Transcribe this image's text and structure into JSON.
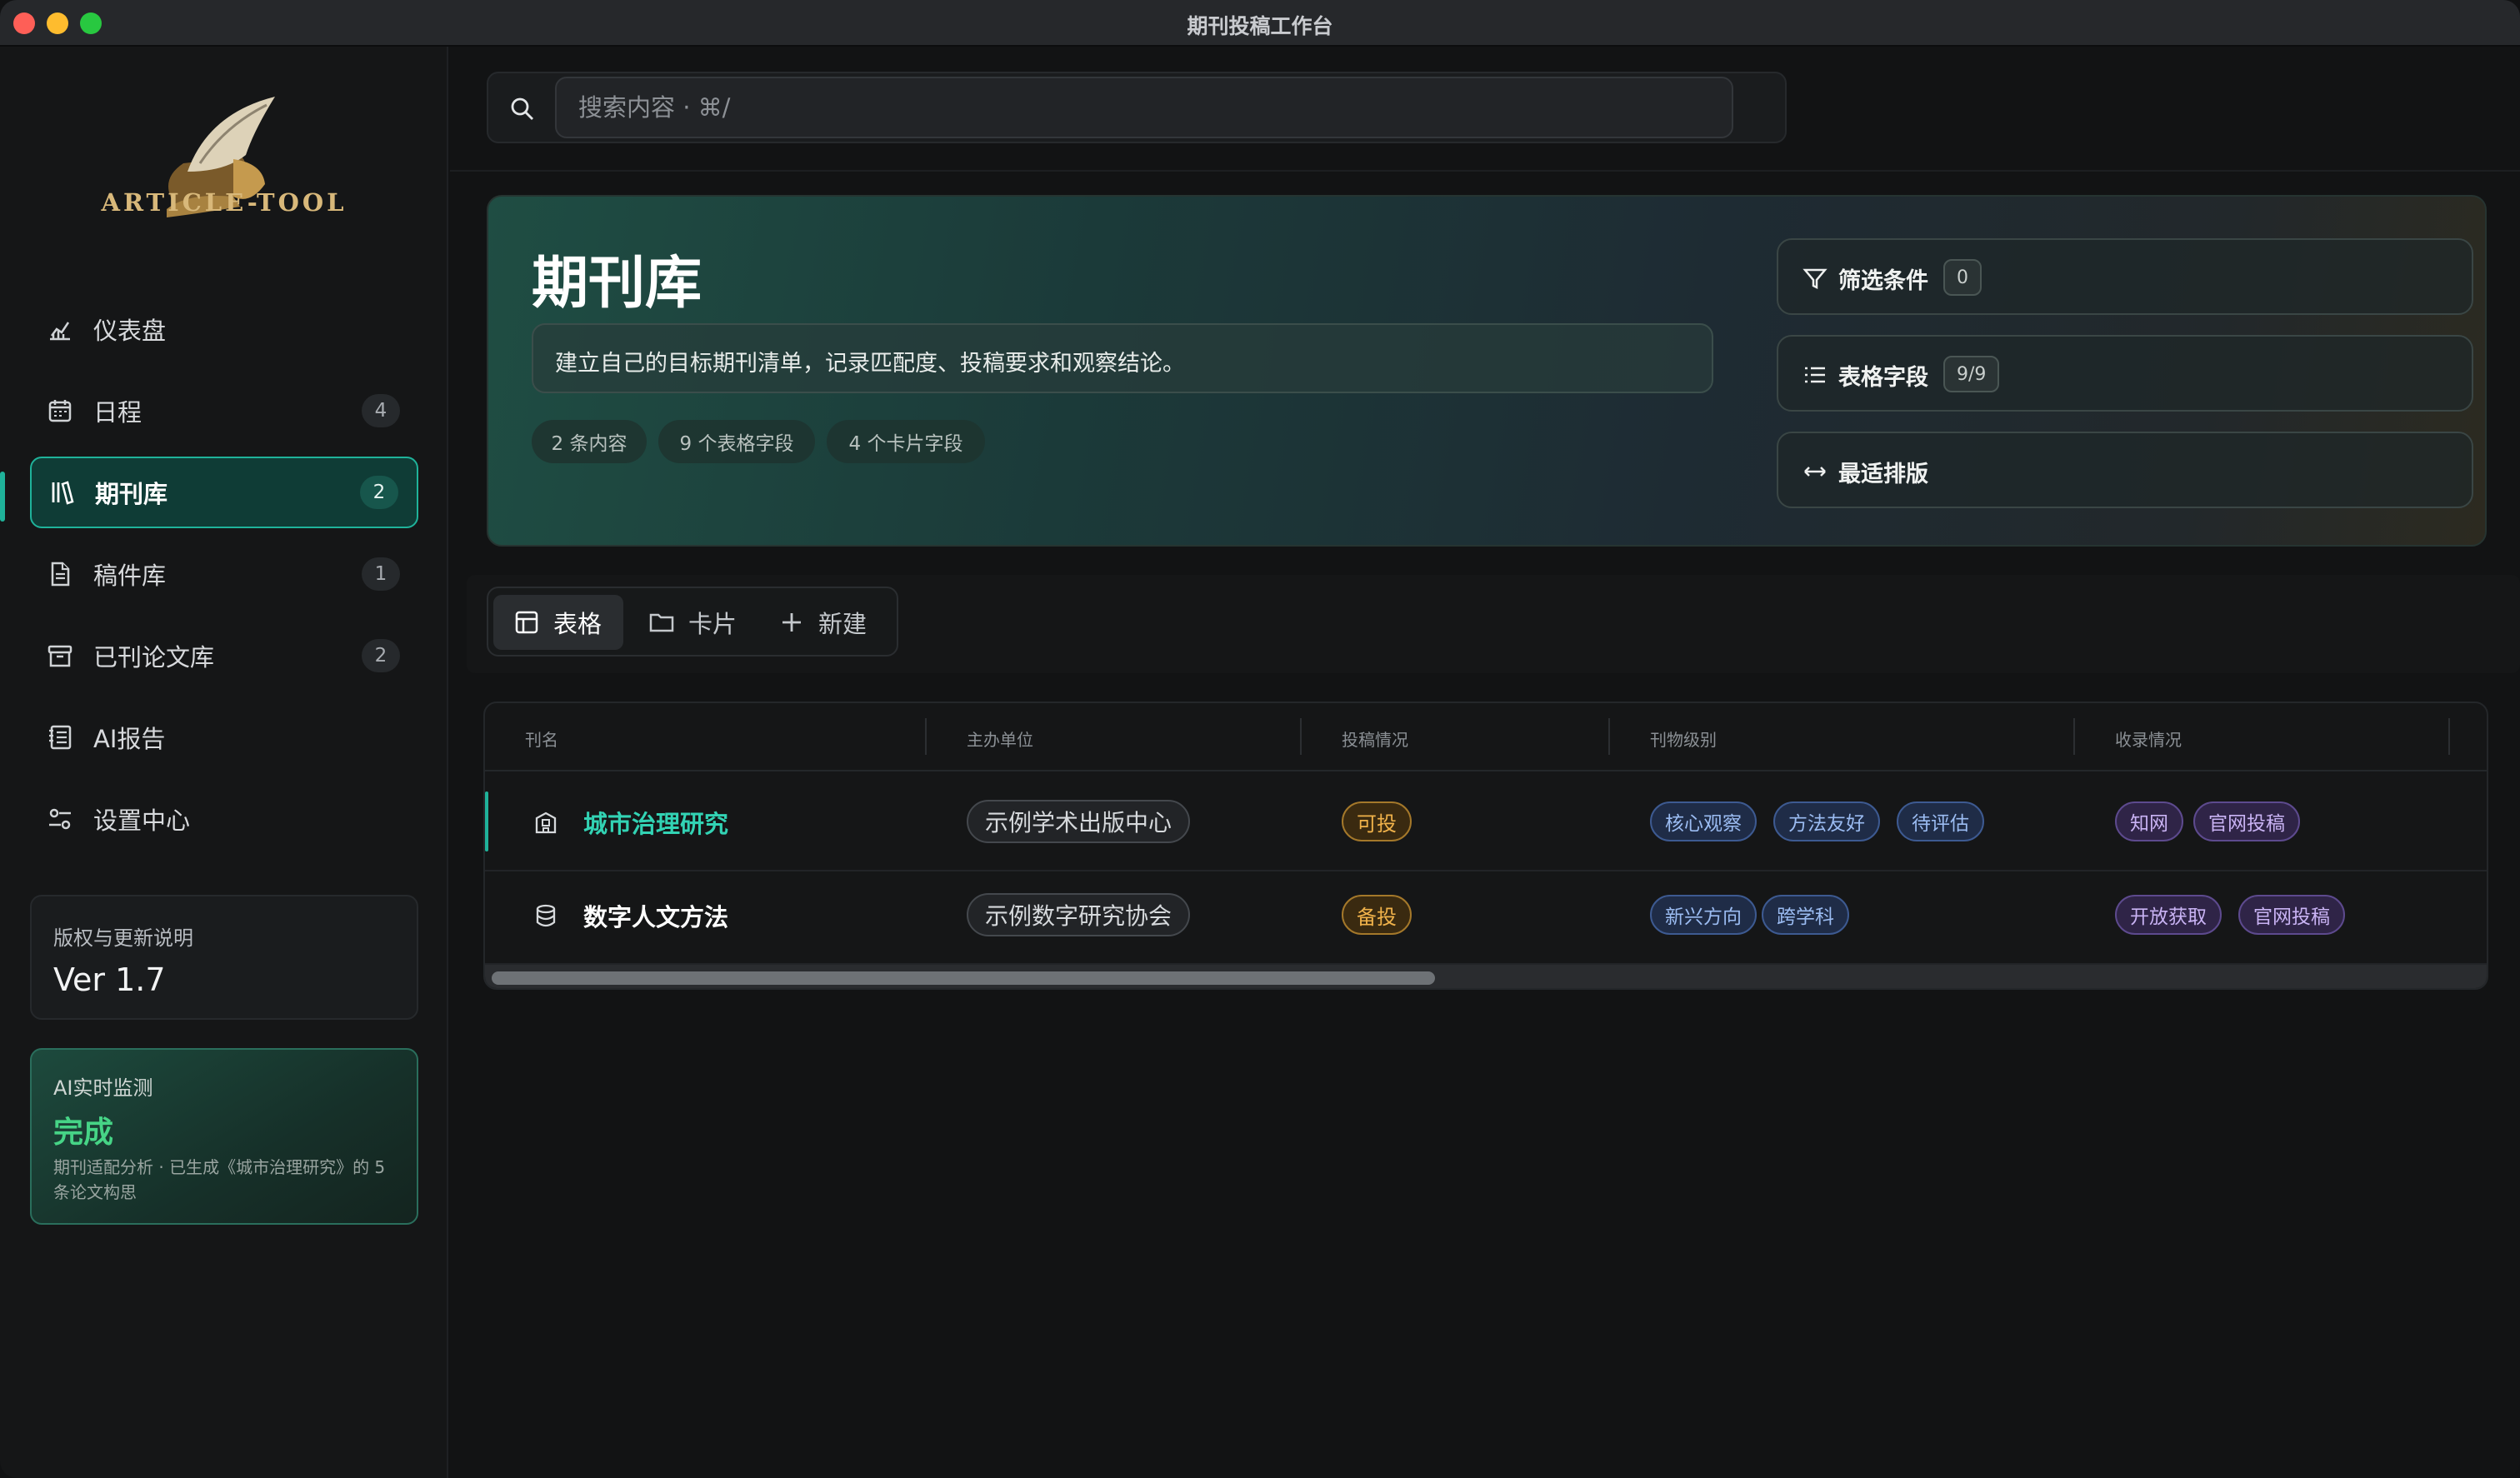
{
  "window": {
    "title": "期刊投稿工作台"
  },
  "brand": {
    "logo_text": "ARTICLE-TOOL"
  },
  "sidebar": {
    "items": [
      {
        "label": "仪表盘",
        "badge": null,
        "icon": "chart-icon"
      },
      {
        "label": "日程",
        "badge": "4",
        "icon": "calendar-icon"
      },
      {
        "label": "期刊库",
        "badge": "2",
        "icon": "library-icon",
        "active": true
      },
      {
        "label": "稿件库",
        "badge": "1",
        "icon": "document-icon"
      },
      {
        "label": "已刊论文库",
        "badge": "2",
        "icon": "archive-icon"
      },
      {
        "label": "AI报告",
        "badge": null,
        "icon": "report-icon"
      },
      {
        "label": "设置中心",
        "badge": null,
        "icon": "settings-icon"
      }
    ],
    "version": {
      "label": "版权与更新说明",
      "value": "Ver 1.7"
    },
    "ai_monitor": {
      "label": "AI实时监测",
      "status": "完成",
      "desc": "期刊适配分析 · 已生成《城市治理研究》的 5 条论文构思"
    }
  },
  "search": {
    "placeholder": "搜索内容 · ⌘/"
  },
  "hero": {
    "title": "期刊库",
    "desc": "建立自己的目标期刊清单，记录匹配度、投稿要求和观察结论。",
    "chips": [
      "2 条内容",
      "9 个表格字段",
      "4 个卡片字段"
    ],
    "filter": {
      "label": "筛选条件",
      "badge": "0"
    },
    "fields": {
      "label": "表格字段",
      "badge": "9/9"
    },
    "layout": {
      "label": "最适排版"
    }
  },
  "view_tabs": [
    {
      "label": "表格",
      "icon": "table-icon",
      "active": true
    },
    {
      "label": "卡片",
      "icon": "folder-icon"
    },
    {
      "label": "新建",
      "icon": "plus-icon"
    }
  ],
  "table": {
    "columns": [
      "刊名",
      "主办单位",
      "投稿情况",
      "刊物级别",
      "收录情况"
    ],
    "rows": [
      {
        "name": "城市治理研究",
        "icon": "building-icon",
        "unit": "示例学术出版中心",
        "status": "可投",
        "levels": [
          "核心观察",
          "方法友好",
          "待评估"
        ],
        "indexes": [
          "知网",
          "官网投稿"
        ]
      },
      {
        "name": "数字人文方法",
        "icon": "database-icon",
        "unit": "示例数字研究协会",
        "status": "备投",
        "levels": [
          "新兴方向",
          "跨学科"
        ],
        "indexes": [
          "开放获取",
          "官网投稿"
        ]
      }
    ],
    "scroll_position": 0.0
  },
  "colors": {
    "accent": "#1fb29a",
    "success": "#46d486",
    "status_amber": "#f0b24a",
    "level_blue": "#9bbcf2",
    "index_purple": "#c9b3f4"
  }
}
